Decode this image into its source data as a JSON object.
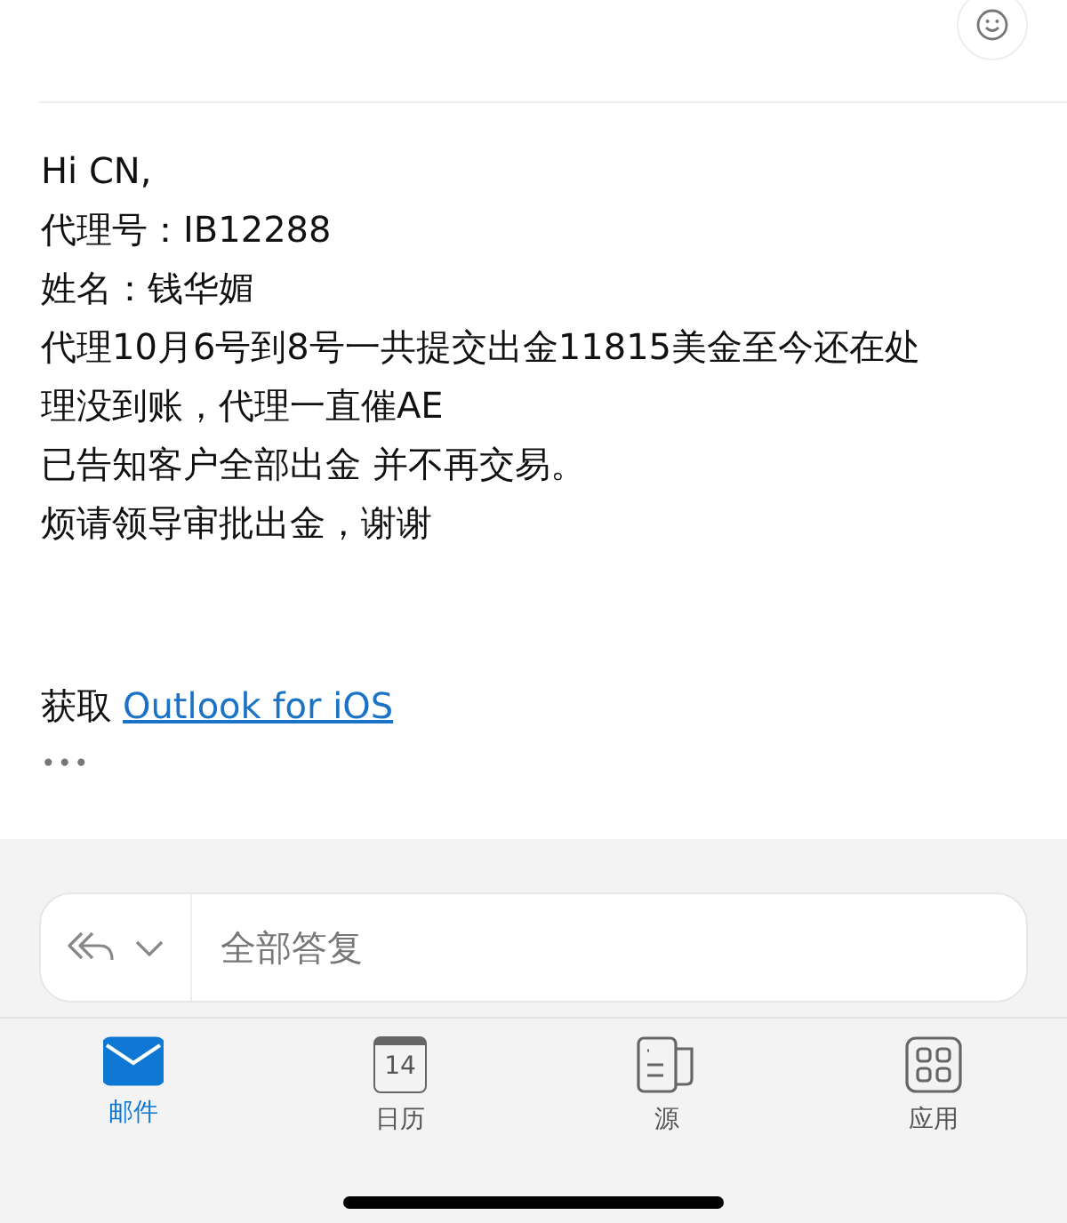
{
  "body": {
    "lines": [
      "Hi CN,",
      "代理号：IB12288",
      "姓名：钱华媚",
      "代理10月6号到8号一共提交出金11815美金至今还在处",
      "理没到账，代理一直催AE",
      "已告知客户全部出金 并不再交易。",
      "烦请领导审批出金，谢谢"
    ],
    "signature_prefix": "获取",
    "signature_link": "Outlook for iOS",
    "more": "•••"
  },
  "reply": {
    "placeholder": "全部答复"
  },
  "tabs": [
    {
      "kind": "mail",
      "label": "邮件",
      "selected": true
    },
    {
      "kind": "calendar",
      "label": "日历",
      "icon_text": "14",
      "selected": false
    },
    {
      "kind": "feed",
      "label": "源",
      "selected": false
    },
    {
      "kind": "apps",
      "label": "应用",
      "selected": false
    }
  ]
}
